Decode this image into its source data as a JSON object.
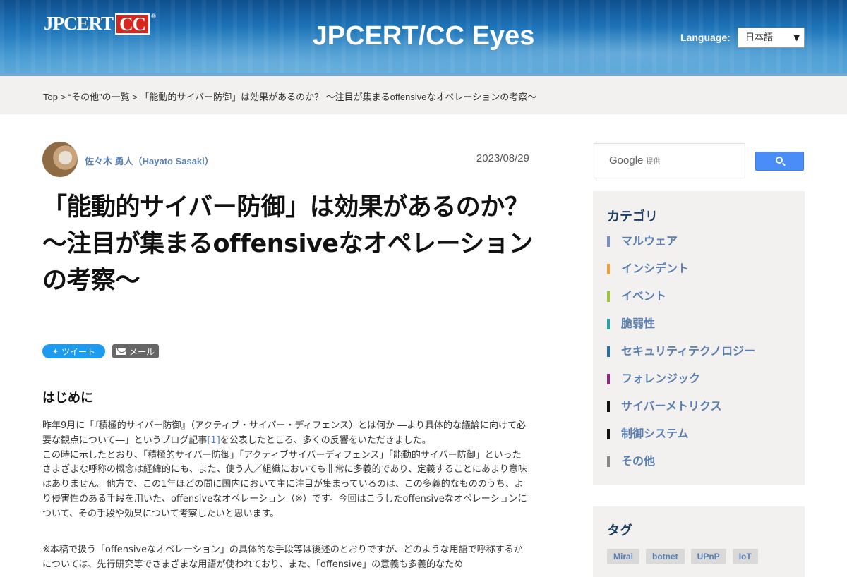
{
  "header": {
    "logo_text": "JPCERT",
    "logo_cc": "CC",
    "logo_reg": "®",
    "site_title": "JPCERT/CC Eyes",
    "language_label": "Language:",
    "language_selected": "日本語"
  },
  "breadcrumb": {
    "top": "Top",
    "sep": ">",
    "category": "“その他”の一覧",
    "current": "「能動的サイバー防御」は効果があるのか？ ～注目が集まるoffensiveなオペレーションの考察～"
  },
  "post": {
    "author": "佐々木 勇人（Hayato Sasaki）",
    "date": "2023/08/29",
    "title": "「能動的サイバー防御」は効果があるのか？ ～注目が集まるoffensiveなオペレーションの考察～",
    "share": {
      "tweet_label": "ツイート",
      "mail_label": "メール"
    },
    "section_heading": "はじめに",
    "para1_before_ref": "昨年9月に「『積極的サイバー防御』（アクティブ・サイバー・ディフェンス）とは何か ―より具体的な議論に向けて必要な観点について―」というブログ記事",
    "para1_ref": "[1]",
    "para1_after_ref": "を公表したところ、多くの反響をいただきました。",
    "para2": "この時に示したとおり、「積極的サイバー防御」「アクティブサイバーディフェンス」「能動的サイバー防御」といったさまざまな呼称の概念は経緯的にも、また、使う人／組織においても非常に多義的であり、定義することにあまり意味はありません。他方で、この1年ほどの間に国内において主に注目が集まっているのは、この多義的なもののうち、より侵害性のある手段を用いた、offensiveなオペレーション（※）です。今回はこうしたoffensiveなオペレーションについて、その手段や効果について考察したいと思います。",
    "note": "※本稿で扱う「offensiveなオペレーション」の具体的な手段等は後述のとおりですが、どのような用語で呼称するかについては、先行研究等でさまざまな用語が使われており、また、「offensive」の意義も多義的なため"
  },
  "sidebar": {
    "search_brand": "Google",
    "search_provided": "提供",
    "categories_heading": "カテゴリ",
    "categories": [
      {
        "label": "マルウェア",
        "color": "#7b8fc0"
      },
      {
        "label": "インシデント",
        "color": "#e8a03a"
      },
      {
        "label": "イベント",
        "color": "#9ec43a"
      },
      {
        "label": "脆弱性",
        "color": "#2aa0a4"
      },
      {
        "label": "セキュリティテクノロジー",
        "color": "#2a6fa0"
      },
      {
        "label": "フォレンジック",
        "color": "#8a2a7a"
      },
      {
        "label": "サイバーメトリクス",
        "color": "#111111"
      },
      {
        "label": "制御システム",
        "color": "#111111"
      },
      {
        "label": "その他",
        "color": "#888888"
      }
    ],
    "tags_heading": "タグ",
    "tags": [
      "Mirai",
      "botnet",
      "UPnP",
      "IoT"
    ]
  }
}
